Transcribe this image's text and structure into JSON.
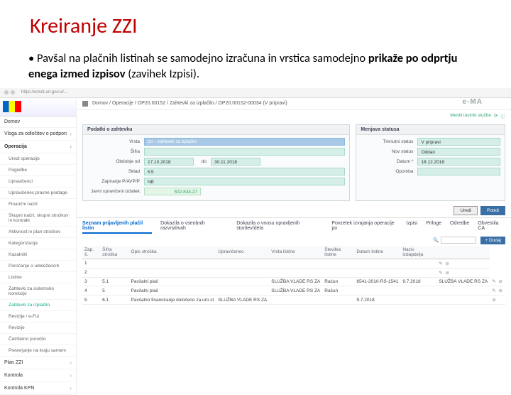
{
  "slide": {
    "title": "Kreiranje ZZI",
    "bullet_pre": "Pavšal na plačnih listinah se samodejno izračuna in vrstica samodejno ",
    "bullet_bold": "prikaže po odprtju enega izmed izpisov",
    "bullet_post": " (zavihek Izpisi)."
  },
  "browser": {
    "url": "https://emait.arr.gov.si/..."
  },
  "sidebar": {
    "logo_text": "e-MA",
    "items": [
      {
        "label": "Domov",
        "expand": false
      },
      {
        "label": "Vloga za odločitev o podpori",
        "expand": true
      },
      {
        "label": "Operacija",
        "expand": true,
        "active": true
      },
      {
        "label": "Uredi operacijo",
        "sub": true
      },
      {
        "label": "Pogodbe",
        "sub": true
      },
      {
        "label": "Upravičenci",
        "sub": true
      },
      {
        "label": "Upravičenec pravne podlage",
        "sub": true
      },
      {
        "label": "Finančni načrt",
        "sub": true
      },
      {
        "label": "Skupni načrt, skupni stroškov in kontrakt",
        "sub": true
      },
      {
        "label": "Aktivnost in plan stroškov",
        "sub": true
      },
      {
        "label": "Kategorizacija",
        "sub": true
      },
      {
        "label": "Kazalniki",
        "sub": true
      },
      {
        "label": "Poročanje o udeležencih",
        "sub": true
      },
      {
        "label": "Listine",
        "sub": true
      },
      {
        "label": "Zahtevki za sistemsko korekcijo",
        "sub": true
      },
      {
        "label": "Zahtevki za izplačilo",
        "sub": true,
        "hl": true
      },
      {
        "label": "Revizije / e-Ful",
        "sub": true
      },
      {
        "label": "Revizije",
        "sub": true
      },
      {
        "label": "Četrtletno poročilo",
        "sub": true
      },
      {
        "label": "Preverjanje na kraju samem",
        "sub": true
      },
      {
        "label": "Plan ZZI",
        "expand": true
      },
      {
        "label": "Kontrola",
        "expand": true
      },
      {
        "label": "Kontrola KPN",
        "expand": true
      }
    ]
  },
  "crumbs": [
    "Domov",
    "Operacije",
    "OP20.00152",
    "Zahtevki za izplačilo",
    "OP20.00152-00034 (V pripravi)"
  ],
  "toolbar_right": "Menili lastnik službe",
  "left_panel": {
    "title": "Podatki o zahtevku",
    "rows": [
      {
        "label": "Vrsta",
        "value": "zzi – zahtevek za izplačilo",
        "cls": "blue"
      },
      {
        "label": "Šifra",
        "value": "",
        "cls": "teal"
      },
      {
        "label": "Obdobje od",
        "value": "17.10.2018",
        "cls": "teal small",
        "extra_label": "do",
        "extra_value": "30.11.2018"
      },
      {
        "label": "Sklad",
        "value": "KS",
        "cls": "teal"
      },
      {
        "label": "Zapiranje P/AVP/P",
        "value": "NE",
        "cls": "teal"
      },
      {
        "label": "Javni upravičeni izdatek",
        "value": "502.834,27",
        "cls": "green"
      }
    ]
  },
  "right_panel": {
    "title": "Menjava statusa",
    "rows": [
      {
        "label": "Trenutni status",
        "value": "V pripravi"
      },
      {
        "label": "Nov status",
        "value": "Oddan"
      },
      {
        "label": "Datum *",
        "value": "18.12.2018"
      },
      {
        "label": "Opomba",
        "value": ""
      }
    ]
  },
  "buttons": {
    "cancel": "Uredi",
    "save": "Potrdi"
  },
  "tabs": [
    "Seznam prijavljenih plačil listin",
    "Dokazila o vseobnih razvrstitvah",
    "Dokazila o vnosu opravljenih storitev/dela",
    "Povzetek izvajanja operacije po",
    "Izpisi",
    "Priloge",
    "Odredbe",
    "Obvestila CA"
  ],
  "active_tab": 0,
  "grid": {
    "search_icon": "Q",
    "add": "+ Dodaj",
    "cols": [
      "Zap. š.",
      "Šifra stroška",
      "Opis stroška",
      "Upravičenec",
      "Vrsta listine",
      "Številka listine",
      "Datum listine",
      "Naziv izdajatelja",
      ""
    ],
    "rows": [
      {
        "c": [
          "1",
          "",
          "",
          "",
          "",
          "",
          "",
          "",
          "✎ ⊘"
        ]
      },
      {
        "c": [
          "2",
          "",
          "",
          "",
          "",
          "",
          "",
          "",
          "✎ ⊘"
        ]
      },
      {
        "c": [
          "3",
          "5.1",
          "Pavšalni plač",
          "",
          "SLUŽBA VLADE RS ZA",
          "Račun",
          "6541-2010-RS-1541",
          "9.7.2018",
          "SLUŽBA VLADE RS ZA",
          "✎ ⊘"
        ]
      },
      {
        "c": [
          "4",
          "5",
          "Pavšalni plač",
          "",
          "SLUŽBA VLADE RS ZA",
          "Račun",
          "",
          "",
          "",
          "✎ ⊘"
        ]
      },
      {
        "c": [
          "5",
          "6.1",
          "Pavšalno financiranje določeno za uro st",
          "SLUŽBA VLADE RS ZA",
          "",
          "",
          "9.7.2018",
          "",
          "",
          "⊘"
        ]
      }
    ]
  }
}
